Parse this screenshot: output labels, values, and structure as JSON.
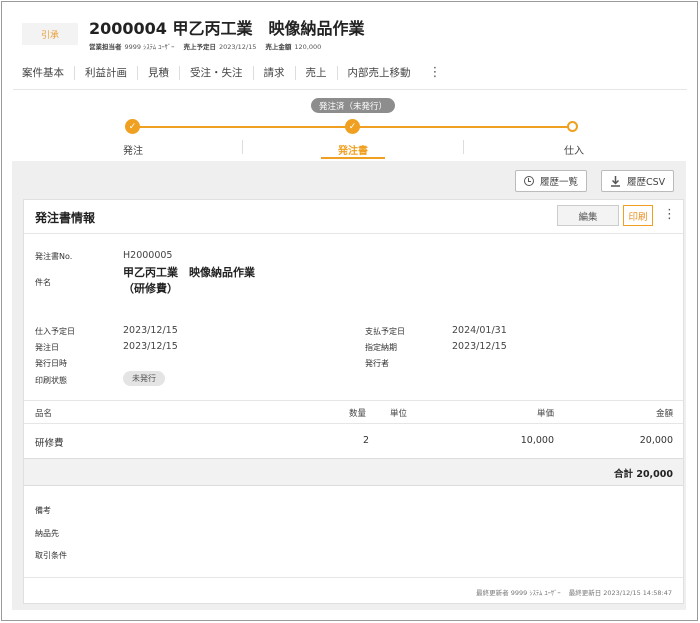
{
  "header": {
    "badge": "引承",
    "title": "2000004 甲乙丙工業　映像納品作業",
    "meta": [
      {
        "label": "営業担当者",
        "value": "9999 ｼｽﾃﾑ ﾕｰｻﾞｰ"
      },
      {
        "label": "売上予定日",
        "value": "2023/12/15"
      },
      {
        "label": "売上金額",
        "value": "120,000"
      }
    ]
  },
  "tabs": [
    "案件基本",
    "利益計画",
    "見積",
    "受注・失注",
    "請求",
    "売上",
    "内部売上移動"
  ],
  "stepper": {
    "status": "発注済（未発行）",
    "steps": [
      {
        "label": "発注",
        "done": true
      },
      {
        "label": "発注書",
        "done": true,
        "active": true
      },
      {
        "label": "仕入",
        "done": false
      }
    ]
  },
  "actions": {
    "history_list": "履歴一覧",
    "history_csv": "履歴CSV"
  },
  "card": {
    "title": "発注書情報",
    "edit": "編集",
    "print": "印刷",
    "po_no_label": "発注書No.",
    "po_no": "H2000005",
    "subject_label": "件名",
    "subject_line1": "甲乙丙工業　映像納品作業",
    "subject_line2": "（研修費）",
    "left_fields": [
      {
        "label": "仕入予定日",
        "value": "2023/12/15"
      },
      {
        "label": "発注日",
        "value": "2023/12/15"
      },
      {
        "label": "発行日時",
        "value": ""
      },
      {
        "label": "印刷状態",
        "value": ""
      }
    ],
    "print_status": "未発行",
    "right_fields": [
      {
        "label": "支払予定日",
        "value": "2024/01/31"
      },
      {
        "label": "指定納期",
        "value": "2023/12/15"
      },
      {
        "label": "発行者",
        "value": ""
      }
    ]
  },
  "table": {
    "headers": {
      "item": "品名",
      "qty": "数量",
      "unit": "単位",
      "price": "単価",
      "amount": "金額"
    },
    "rows": [
      {
        "item": "研修費",
        "qty": "2",
        "unit": "",
        "price": "10,000",
        "amount": "20,000"
      }
    ],
    "total": "合計 20,000"
  },
  "notes": {
    "remarks": "備考",
    "delivery": "納品先",
    "terms": "取引条件"
  },
  "footer": {
    "updated_by_label": "最終更新者",
    "updated_by": "9999 ｼｽﾃﾑ ﾕｰｻﾞｰ",
    "updated_at_label": "最終更新日",
    "updated_at": "2023/12/15 14:58:47"
  },
  "colors": {
    "accent": "#f0a020",
    "pill": "#8d8d8d"
  }
}
